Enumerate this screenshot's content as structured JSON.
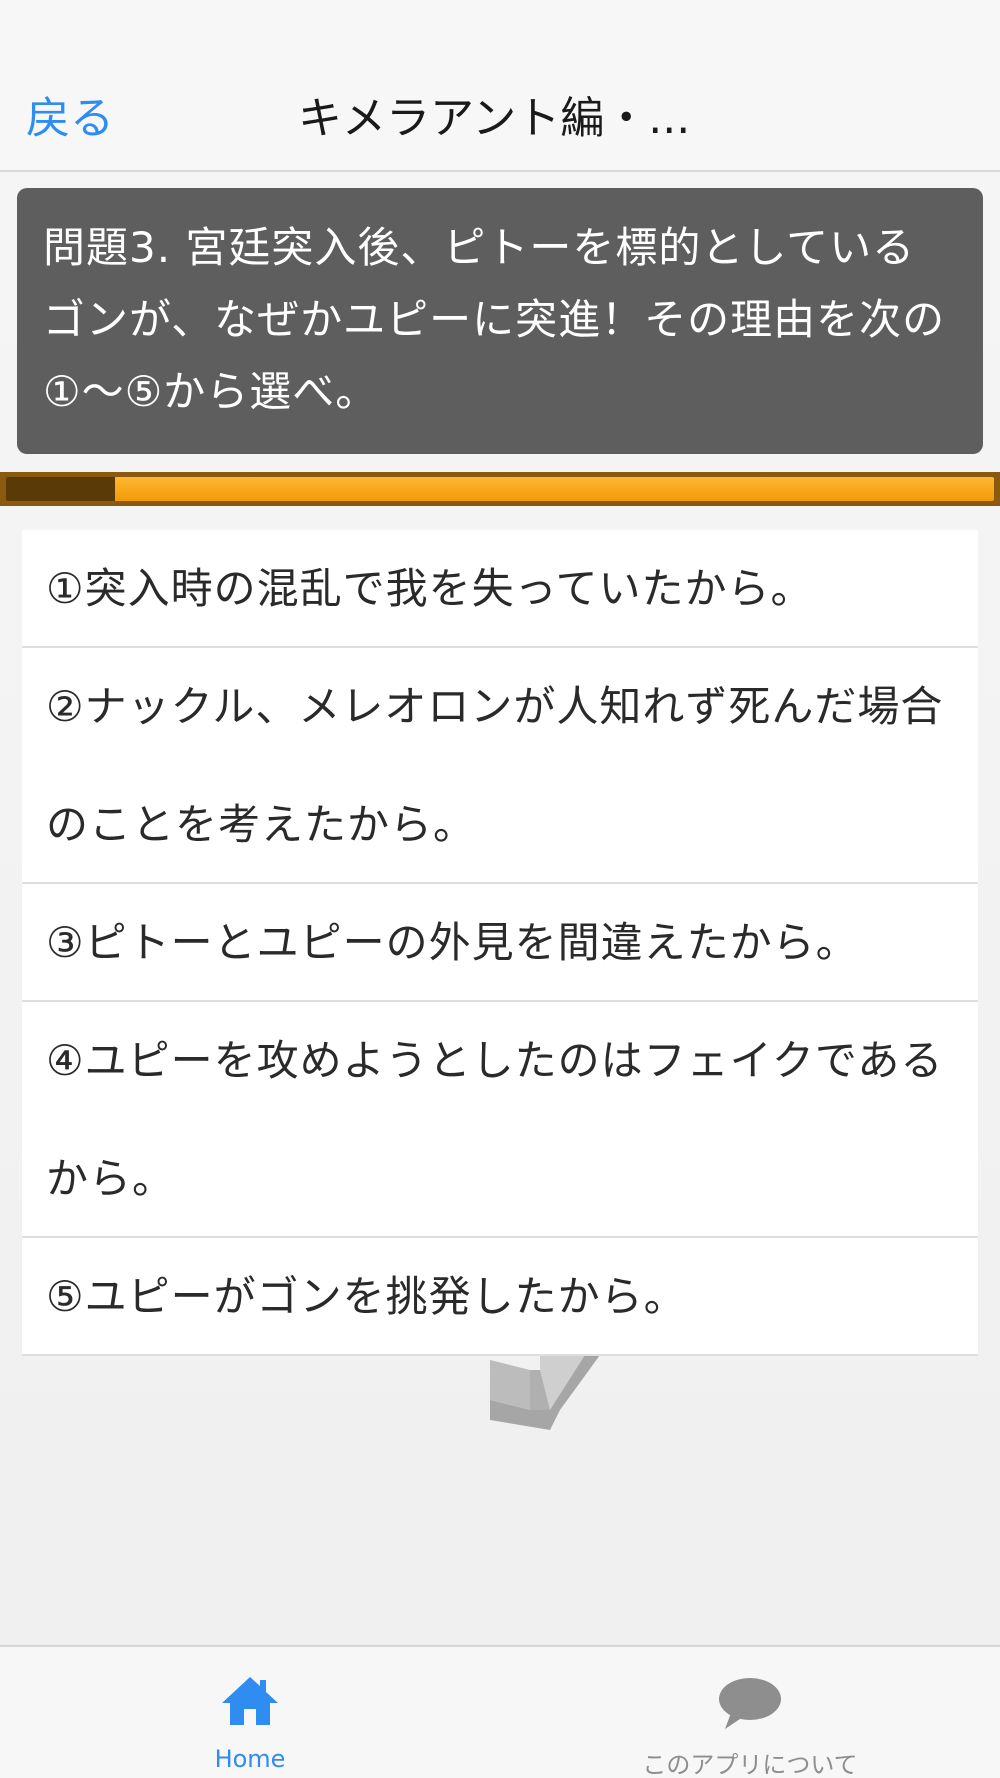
{
  "navbar": {
    "back_label": "戻る",
    "title": "キメラアント編・..."
  },
  "question": {
    "text": "問題3. 宮廷突入後、ピトーを標的としているゴンが、なぜかユピーに突進！その理由を次の①〜⑤から選べ。"
  },
  "timer": {
    "elapsed_fraction": 0.11
  },
  "options": [
    {
      "label": "①突入時の混乱で我を失っていたから。"
    },
    {
      "label": "②ナックル、メレオロンが人知れず死んだ場合のことを考えたから。"
    },
    {
      "label": "③ピトーとユピーの外見を間違えたから。"
    },
    {
      "label": "④ユピーを攻めようとしたのはフェイクであるから。"
    },
    {
      "label": "⑤ユピーがゴンを挑発したから。"
    }
  ],
  "tabbar": {
    "home_label": "Home",
    "about_label": "このアプリについて",
    "active_color": "#2f8cf0",
    "inactive_color": "#8e8e8e"
  },
  "colors": {
    "accent": "#2f8cf0",
    "question_bg": "#5e5e5e",
    "timer_fill": "#f29a08",
    "timer_elapsed": "#5a3a06"
  }
}
